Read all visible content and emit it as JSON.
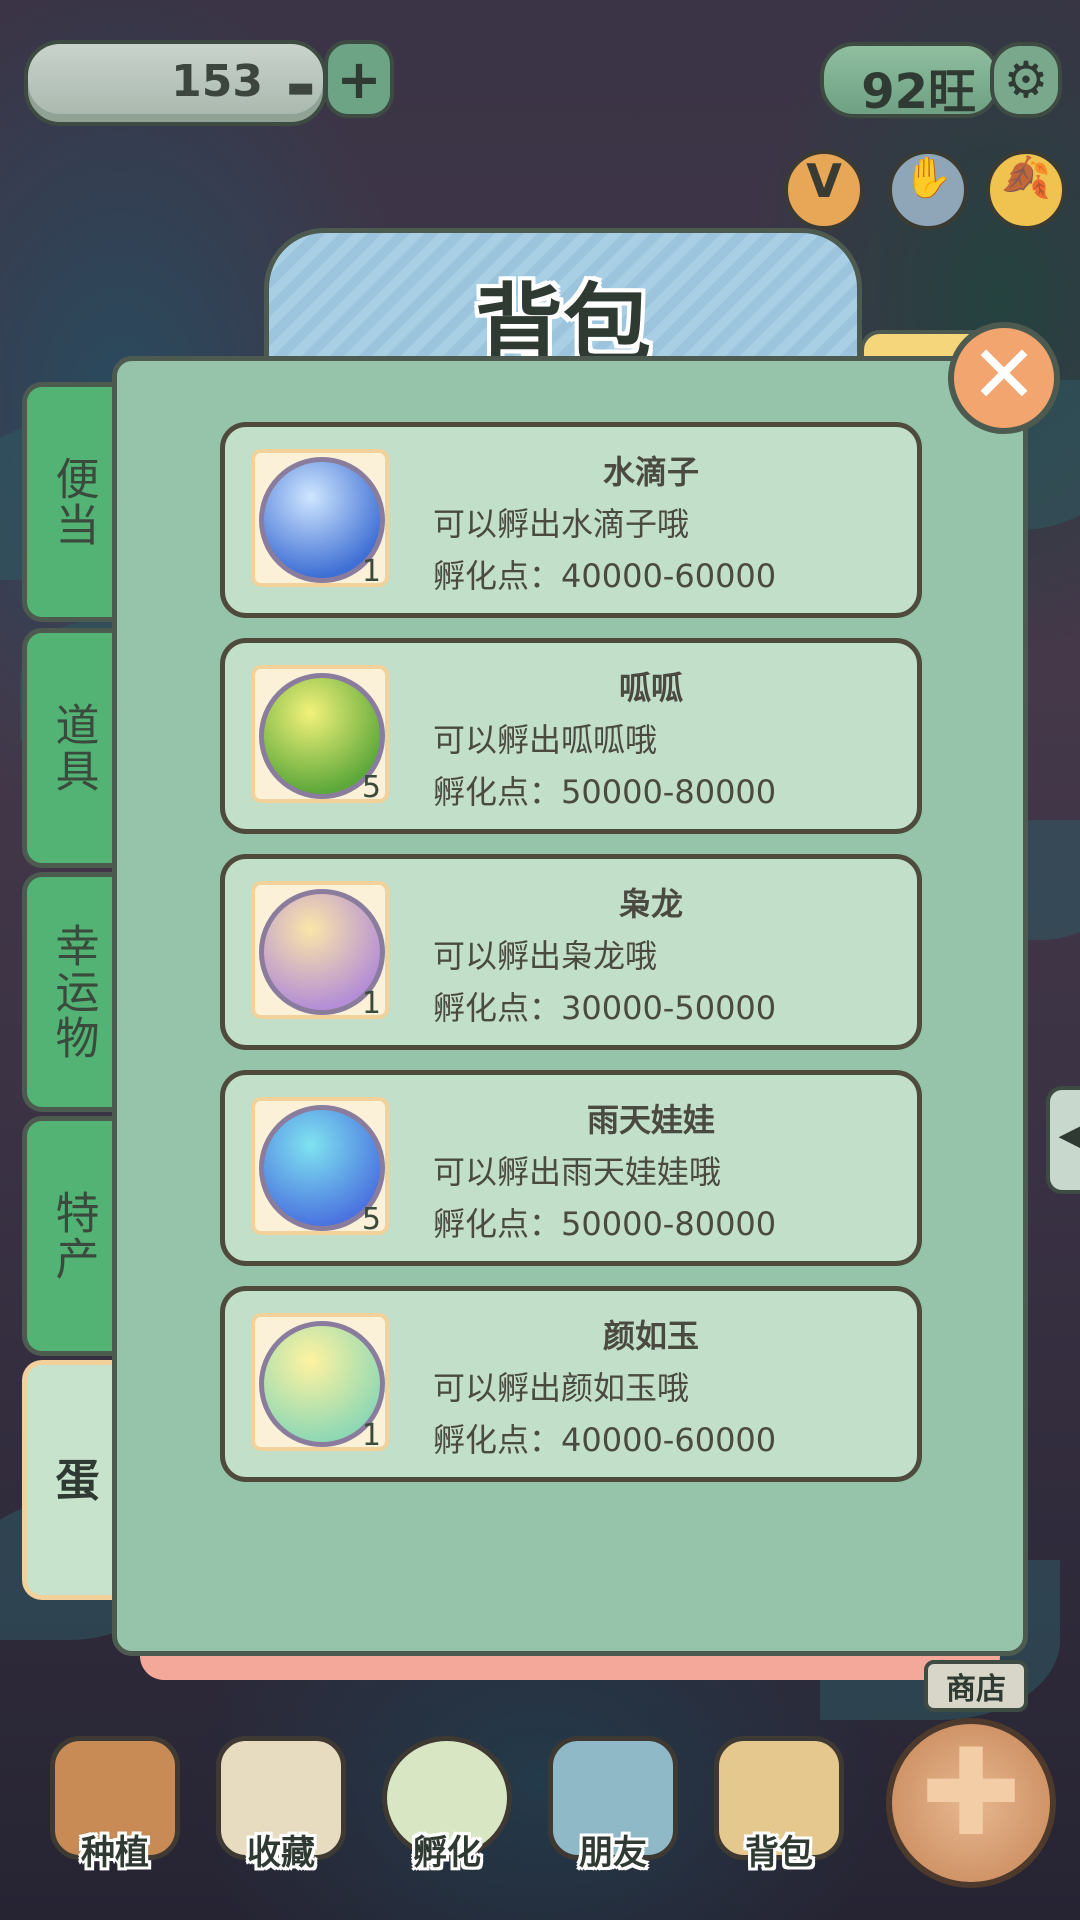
{
  "topbar": {
    "coins": "153",
    "coin_icon": "gold-ingot-icon",
    "add_icon": "plus-icon",
    "wang": "92旺",
    "settings_icon": "gear-icon",
    "quick_buttons": [
      {
        "icon": "v-badge-icon",
        "glyph": "V"
      },
      {
        "icon": "hand-icon",
        "glyph": "✋"
      },
      {
        "icon": "ginkgo-leaf-icon",
        "glyph": "🍂"
      }
    ]
  },
  "panel": {
    "title": "背包",
    "close_icon": "close-icon",
    "tabs": [
      {
        "label": "便当",
        "active": false
      },
      {
        "label": "道具",
        "active": false
      },
      {
        "label": "幸运物",
        "active": false
      },
      {
        "label": "特产",
        "active": false
      },
      {
        "label": "蛋",
        "active": true
      }
    ],
    "items": [
      {
        "name": "水滴子",
        "desc": "可以孵出水滴子哦",
        "points": "孵化点：40000-60000",
        "qty": "1",
        "colors": [
          "#cfe6ff",
          "#3e6fd4"
        ]
      },
      {
        "name": "呱呱",
        "desc": "可以孵出呱呱哦",
        "points": "孵化点：50000-80000",
        "qty": "5",
        "colors": [
          "#f2f27a",
          "#5da83a"
        ]
      },
      {
        "name": "枭龙",
        "desc": "可以孵出枭龙哦",
        "points": "孵化点：30000-50000",
        "qty": "1",
        "colors": [
          "#fbe6a8",
          "#b48ed6"
        ]
      },
      {
        "name": "雨天娃娃",
        "desc": "可以孵出雨天娃娃哦",
        "points": "孵化点：50000-80000",
        "qty": "5",
        "colors": [
          "#7fe3f0",
          "#4b74e0"
        ]
      },
      {
        "name": "颜如玉",
        "desc": "可以孵出颜如玉哦",
        "points": "孵化点：40000-60000",
        "qty": "1",
        "colors": [
          "#fff3a0",
          "#8fd8b4"
        ]
      }
    ]
  },
  "bottom_nav": {
    "shop": "商店",
    "items": [
      {
        "label": "种植",
        "icon": "planting-pot-icon",
        "color": "#c98b55"
      },
      {
        "label": "收藏",
        "icon": "collection-book-icon",
        "color": "#e8dcc0"
      },
      {
        "label": "孵化",
        "icon": "egg-icon",
        "color": "#d8e6c4"
      },
      {
        "label": "朋友",
        "icon": "cat-friend-icon",
        "color": "#8fb9c6"
      },
      {
        "label": "背包",
        "icon": "basket-icon",
        "color": "#e4c88e"
      }
    ],
    "main_icon": "cross-action-icon"
  },
  "side_arrow_icon": "chevron-left-icon"
}
